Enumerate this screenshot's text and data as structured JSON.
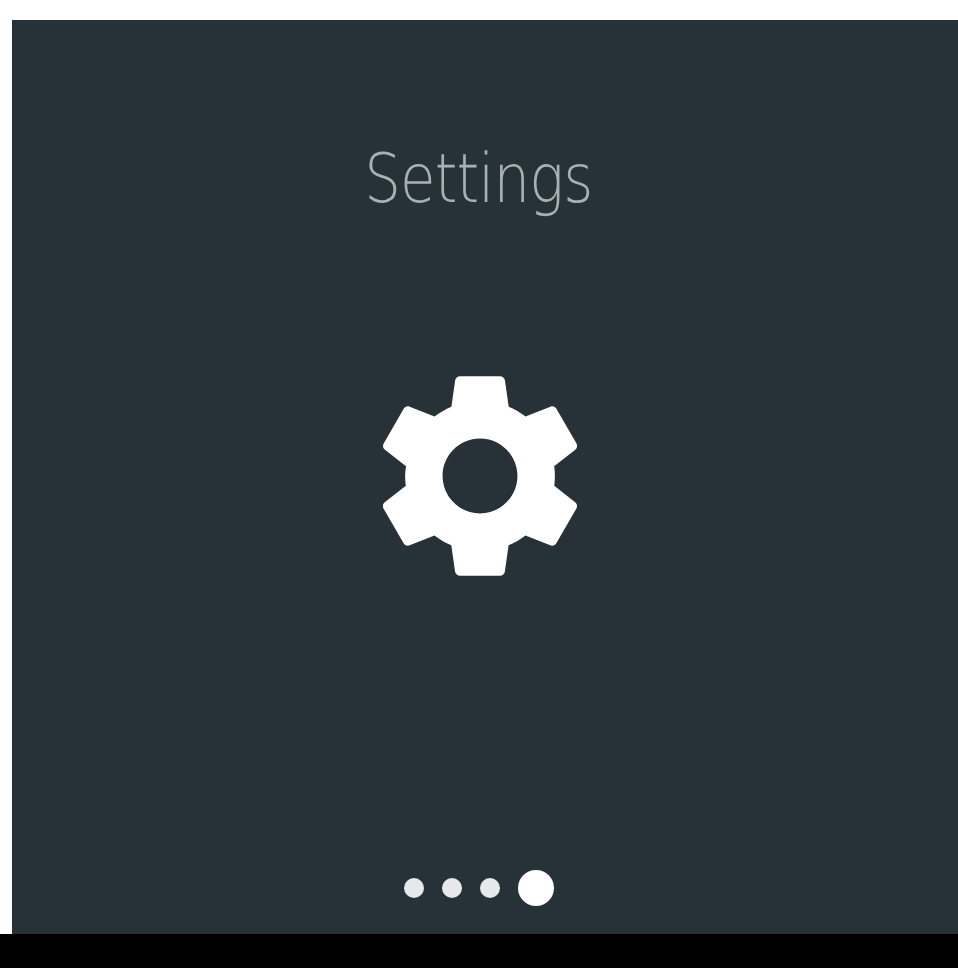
{
  "title": "Settings",
  "pages": [
    {
      "selected": false
    },
    {
      "selected": false
    },
    {
      "selected": false
    },
    {
      "selected": true
    }
  ]
}
